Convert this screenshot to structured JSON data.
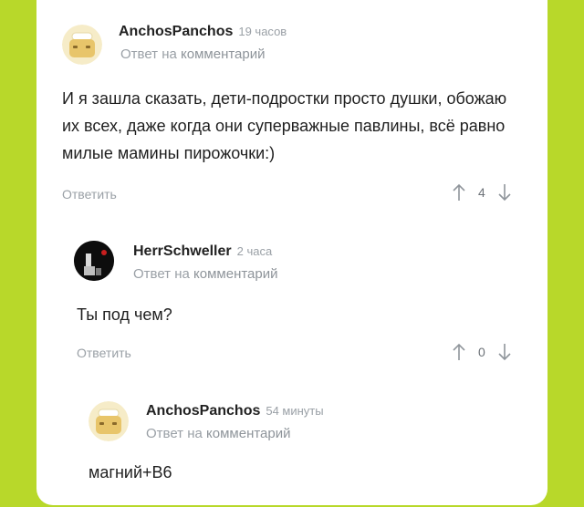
{
  "comments": [
    {
      "author": "AnchosPanchos",
      "time": "19 часов",
      "reply_prefix": "Ответ на",
      "reply_link": "комментарий",
      "body": "И я зашла сказать, дети-подростки просто душки, обожаю их всех, даже когда они суперважные павлины, всё равно милые мамины пирожочки:)",
      "reply_label": "Ответить",
      "votes": "4",
      "avatar_icon": "toaster-avatar-icon"
    },
    {
      "author": "HerrSchweller",
      "time": "2 часа",
      "reply_prefix": "Ответ на",
      "reply_link": "комментарий",
      "body": "Ты под чем?",
      "reply_label": "Ответить",
      "votes": "0",
      "avatar_icon": "dark-figure-avatar-icon"
    },
    {
      "author": "AnchosPanchos",
      "time": "54 минуты",
      "reply_prefix": "Ответ на",
      "reply_link": "комментарий",
      "body": "магний+В6",
      "avatar_icon": "toaster-avatar-icon"
    }
  ],
  "colors": {
    "background": "#b8d82a",
    "card": "#ffffff",
    "muted_text": "#9aa0a6"
  }
}
